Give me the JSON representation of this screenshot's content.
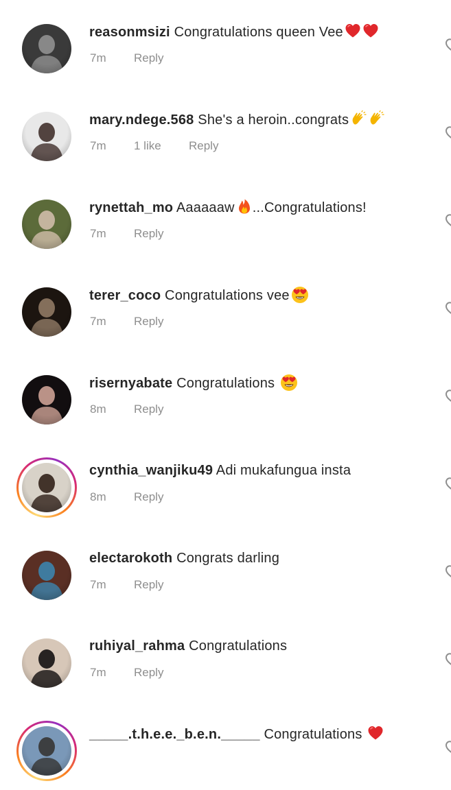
{
  "comments": [
    {
      "username": "reasonmsizi",
      "text": "Congratulations queen Vee",
      "emojis": [
        "red-heart",
        "red-heart"
      ],
      "time": "7m",
      "likes": "",
      "reply": "Reply",
      "story_ring": false,
      "avatar_colors": [
        "#3a3a3a",
        "#8c8c8c"
      ]
    },
    {
      "username": "mary.ndege.568",
      "text": "She's a heroin..congrats",
      "emojis": [
        "clapping-hands",
        "clapping-hands"
      ],
      "time": "7m",
      "likes": "1 like",
      "reply": "Reply",
      "story_ring": false,
      "avatar_colors": [
        "#e8e8e8",
        "#4a3a36"
      ]
    },
    {
      "username": "rynettah_mo",
      "text": "Aaaaaaw",
      "emojis": [
        "fire"
      ],
      "text_after": "...Congratulations!",
      "time": "7m",
      "likes": "",
      "reply": "Reply",
      "story_ring": false,
      "avatar_colors": [
        "#5c6b3a",
        "#c9b8a3"
      ]
    },
    {
      "username": "terer_coco",
      "text": "Congratulations  vee",
      "emojis": [
        "heart-eyes"
      ],
      "time": "7m",
      "likes": "",
      "reply": "Reply",
      "story_ring": false,
      "avatar_colors": [
        "#1c1510",
        "#8a7460"
      ]
    },
    {
      "username": "risernyabate",
      "text": "Congratulations ",
      "emojis": [
        "heart-eyes"
      ],
      "time": "8m",
      "likes": "",
      "reply": "Reply",
      "story_ring": false,
      "avatar_colors": [
        "#120e10",
        "#c49a8e"
      ]
    },
    {
      "username": "cynthia_wanjiku49",
      "text": "Adi mukafungua insta",
      "emojis": [],
      "time": "8m",
      "likes": "",
      "reply": "Reply",
      "story_ring": true,
      "avatar_colors": [
        "#d8d2c8",
        "#3a2a22"
      ]
    },
    {
      "username": "electarokoth",
      "text": "Congrats darling",
      "emojis": [],
      "time": "7m",
      "likes": "",
      "reply": "Reply",
      "story_ring": false,
      "avatar_colors": [
        "#5a2f24",
        "#3e7fa6"
      ]
    },
    {
      "username": "ruhiyal_rahma",
      "text": "Congratulations",
      "emojis": [],
      "time": "7m",
      "likes": "",
      "reply": "Reply",
      "story_ring": false,
      "avatar_colors": [
        "#d7c7b8",
        "#1e1a19"
      ]
    },
    {
      "username": "_____.t.h.e.e._b.e.n._____",
      "text": "Congratulations ",
      "emojis": [
        "red-heart"
      ],
      "time": "",
      "likes": "",
      "reply": "",
      "story_ring": true,
      "avatar_colors": [
        "#7a98b8",
        "#3a3a3a"
      ]
    }
  ],
  "colors": {
    "text": "#262626",
    "meta": "#8e8e8e",
    "heart": "#e0272b"
  },
  "icons": {
    "like": "heart-outline-icon"
  }
}
